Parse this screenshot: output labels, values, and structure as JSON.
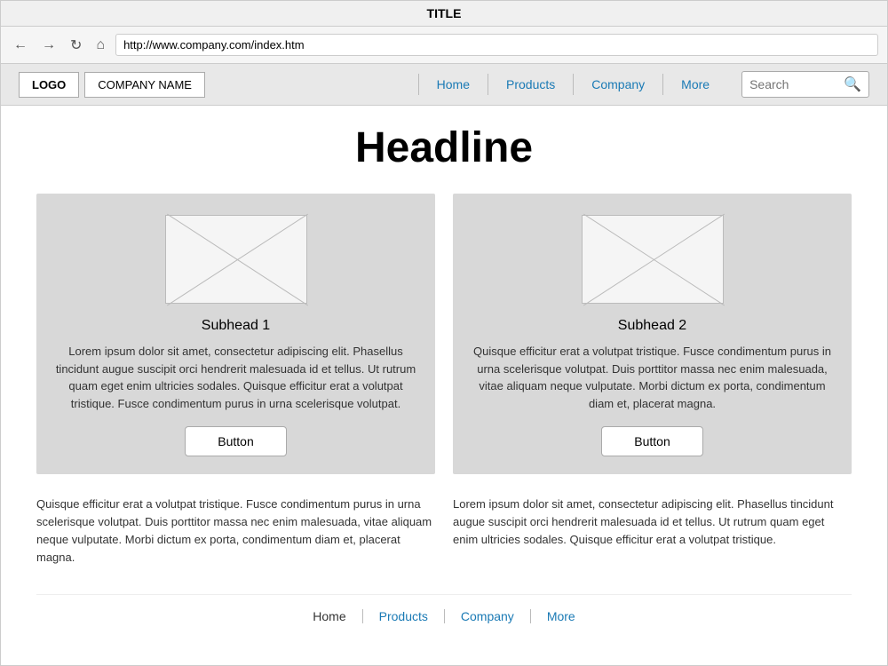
{
  "browser": {
    "title": "TITLE",
    "url": "http://www.company.com/index.htm"
  },
  "header": {
    "logo": "LOGO",
    "company_name": "COMPANY NAME",
    "nav": [
      {
        "label": "Home",
        "href": "#"
      },
      {
        "label": "Products",
        "href": "#"
      },
      {
        "label": "Company",
        "href": "#"
      },
      {
        "label": "More",
        "href": "#"
      }
    ],
    "search_placeholder": "Search"
  },
  "main": {
    "headline": "Headline",
    "cards": [
      {
        "subhead": "Subhead 1",
        "text": "Lorem ipsum dolor sit amet, consectetur adipiscing elit. Phasellus tincidunt augue suscipit orci hendrerit malesuada id et tellus. Ut rutrum quam eget enim ultricies sodales. Quisque efficitur erat a volutpat tristique. Fusce condimentum purus in urna scelerisque volutpat.",
        "button_label": "Button"
      },
      {
        "subhead": "Subhead 2",
        "text": "Quisque efficitur erat a volutpat tristique. Fusce condimentum purus in urna scelerisque volutpat. Duis porttitor massa nec enim malesuada, vitae aliquam neque vulputate. Morbi dictum ex porta, condimentum diam et, placerat magna.",
        "button_label": "Button"
      }
    ],
    "body_texts": [
      "Quisque efficitur erat a volutpat tristique. Fusce condimentum purus in urna scelerisque volutpat. Duis porttitor massa nec enim malesuada, vitae aliquam neque vulputate. Morbi dictum ex porta, condimentum diam et, placerat magna.",
      "Lorem ipsum dolor sit amet, consectetur adipiscing elit. Phasellus tincidunt augue suscipit orci hendrerit malesuada id et tellus. Ut rutrum quam eget enim ultricies sodales. Quisque efficitur erat a volutpat tristique."
    ]
  },
  "footer": {
    "nav": [
      {
        "label": "Home",
        "href": "#",
        "style": "plain"
      },
      {
        "label": "Products",
        "href": "#",
        "style": "link"
      },
      {
        "label": "Company",
        "href": "#",
        "style": "link"
      },
      {
        "label": "More",
        "href": "#",
        "style": "link"
      }
    ]
  }
}
